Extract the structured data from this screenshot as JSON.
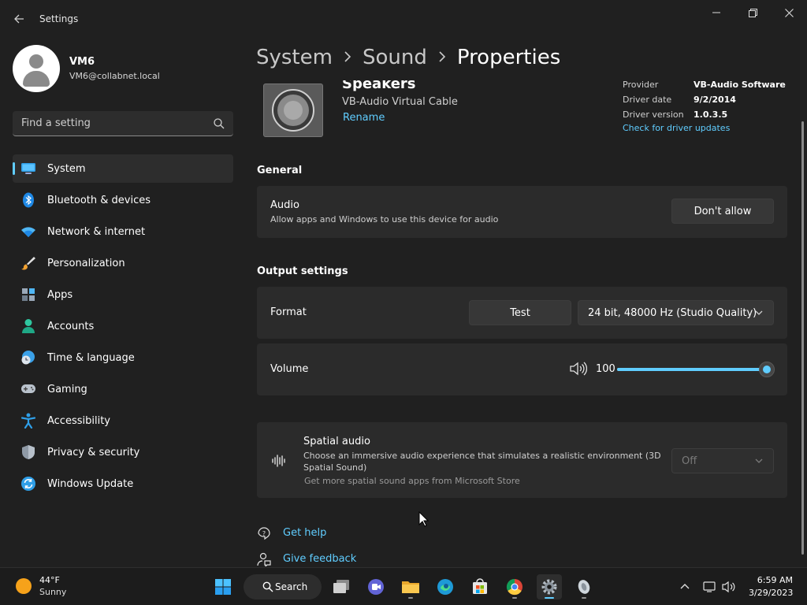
{
  "window": {
    "title": "Settings"
  },
  "profile": {
    "name": "VM6",
    "email": "VM6@collabnet.local"
  },
  "search": {
    "placeholder": "Find a setting"
  },
  "sidebar": {
    "items": [
      {
        "label": "System",
        "icon": "system-icon",
        "active": true
      },
      {
        "label": "Bluetooth & devices",
        "icon": "bluetooth-icon"
      },
      {
        "label": "Network & internet",
        "icon": "wifi-icon"
      },
      {
        "label": "Personalization",
        "icon": "paintbrush-icon"
      },
      {
        "label": "Apps",
        "icon": "apps-icon"
      },
      {
        "label": "Accounts",
        "icon": "person-icon"
      },
      {
        "label": "Time & language",
        "icon": "globe-clock-icon"
      },
      {
        "label": "Gaming",
        "icon": "gamepad-icon"
      },
      {
        "label": "Accessibility",
        "icon": "accessibility-icon"
      },
      {
        "label": "Privacy & security",
        "icon": "shield-icon"
      },
      {
        "label": "Windows Update",
        "icon": "update-icon"
      }
    ]
  },
  "breadcrumb": {
    "items": [
      "System",
      "Sound",
      "Properties"
    ]
  },
  "device": {
    "name": "Speakers",
    "subtitle": "VB-Audio Virtual Cable",
    "rename_label": "Rename",
    "driver": {
      "provider_label": "Provider",
      "provider_value": "VB-Audio Software",
      "date_label": "Driver date",
      "date_value": "9/2/2014",
      "version_label": "Driver version",
      "version_value": "1.0.3.5",
      "update_link": "Check for driver updates"
    }
  },
  "general": {
    "title": "General",
    "audio_title": "Audio",
    "audio_desc": "Allow apps and Windows to use this device for audio",
    "audio_button": "Don't allow"
  },
  "output": {
    "title": "Output settings",
    "format_label": "Format",
    "test_button": "Test",
    "format_value": "24 bit, 48000 Hz (Studio Quality)",
    "volume_label": "Volume",
    "volume_value": "100",
    "volume_level": 1.0
  },
  "spatial": {
    "title": "Spatial audio",
    "desc": "Choose an immersive audio experience that simulates a realistic environment (3D Spatial Sound)",
    "store_link": "Get more spatial sound apps from Microsoft Store",
    "value": "Off"
  },
  "help": {
    "get_help": "Get help",
    "give_feedback": "Give feedback"
  },
  "taskbar": {
    "weather_temp": "44°F",
    "weather_cond": "Sunny",
    "search_label": "Search",
    "time": "6:59 AM",
    "date": "3/29/2023"
  },
  "colors": {
    "accent": "#60cdff",
    "background": "#202020",
    "card": "#2b2b2b"
  }
}
